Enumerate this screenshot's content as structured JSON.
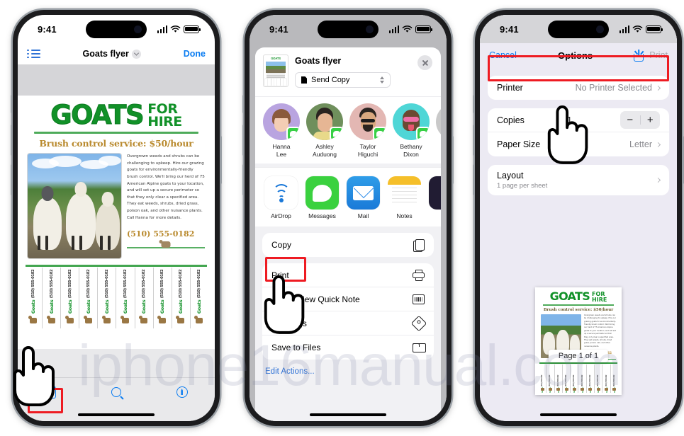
{
  "watermark": "iphone16manual.com",
  "status_bar": {
    "time": "9:41"
  },
  "phone1": {
    "nav": {
      "list_icon": "list-icon",
      "title": "Goats flyer",
      "done": "Done"
    },
    "flyer": {
      "title_main": "GOATS",
      "title_for": "FOR",
      "title_hire": "HIRE",
      "subtitle": "Brush control service: $50/hour",
      "body": "Overgrown weeds and shrubs can be challenging to upkeep. Hire our grazing goats for environmentally-friendly brush control. We'll bring our herd of 75 American Alpine goats to your location, and will set up a secure perimeter so that they only clear a specified area. They eat weeds, shrubs, dried grass, poison oak, and other nuisance plants. Call Hanna for more details.",
      "phone": "(510) 555-0182",
      "tab_label": "Goats",
      "tab_phone": "(510) 555-0182",
      "tab_count": 10
    },
    "toolbar": {
      "share_label": "Share",
      "search_label": "Search",
      "markup_label": "Markup"
    }
  },
  "phone2": {
    "header": {
      "title": "Goats flyer",
      "send_option": "Send Copy",
      "close_label": "Close"
    },
    "contacts": [
      {
        "name_line1": "Hanna",
        "name_line2": "Lee",
        "color": "#b9a4e0",
        "app": "Messages"
      },
      {
        "name_line1": "Ashley",
        "name_line2": "Auduong",
        "color": "#6f8f5c",
        "app": "Messages"
      },
      {
        "name_line1": "Taylor",
        "name_line2": "Higuchi",
        "color": "#e3b7b3",
        "app": "Messages"
      },
      {
        "name_line1": "Bethany",
        "name_line2": "Dixon",
        "color": "#4fd6d6",
        "app": "Messages"
      }
    ],
    "apps": [
      {
        "name": "AirDrop"
      },
      {
        "name": "Messages"
      },
      {
        "name": "Mail"
      },
      {
        "name": "Notes"
      }
    ],
    "actions": [
      {
        "label": "Copy",
        "icon": "copy-icon"
      },
      {
        "label": "Print",
        "icon": "print-icon",
        "highlighted": true
      },
      {
        "label": "Add to New Quick Note",
        "icon": "quick-note-icon"
      },
      {
        "label": "Add Tags",
        "icon": "tag-icon"
      },
      {
        "label": "Save to Files",
        "icon": "folder-icon"
      }
    ],
    "edit_actions": "Edit Actions..."
  },
  "phone3": {
    "nav": {
      "cancel": "Cancel",
      "title": "Options",
      "share_icon": "share-icon",
      "print": "Print"
    },
    "options": {
      "printer_label": "Printer",
      "printer_value": "No Printer Selected",
      "copies_label": "Copies",
      "copies_value": "1",
      "stepper_minus": "−",
      "stepper_plus": "+",
      "paper_size_label": "Paper Size",
      "paper_size_value": "Letter",
      "layout_label": "Layout",
      "layout_value": "1 page per sheet"
    },
    "preview": {
      "title_main": "GOATS",
      "title_for": "FOR",
      "title_hire": "HIRE",
      "subtitle": "Brush control service: $50/hour",
      "body": "Overgrown weeds and shrubs can be challenging to upkeep. Hire our grazing goats for environmentally-friendly brush control. We'll bring our herd of 75 American Alpine goats to your location, and will set up a secure perimeter so that they only clear a specified area. They eat weeds, shrubs, dried grass, poison oak, and other nuisance plants.",
      "phone": "(510) 555-0182",
      "tab_label": "Goats",
      "tab_phone": "(510) 555-0182",
      "page_badge": "Page 1 of 1"
    }
  },
  "colors": {
    "accent_blue": "#0a7cf1",
    "highlight_red": "#ee1b22",
    "brand_green": "#119128",
    "brand_gold": "#b98a2e"
  }
}
